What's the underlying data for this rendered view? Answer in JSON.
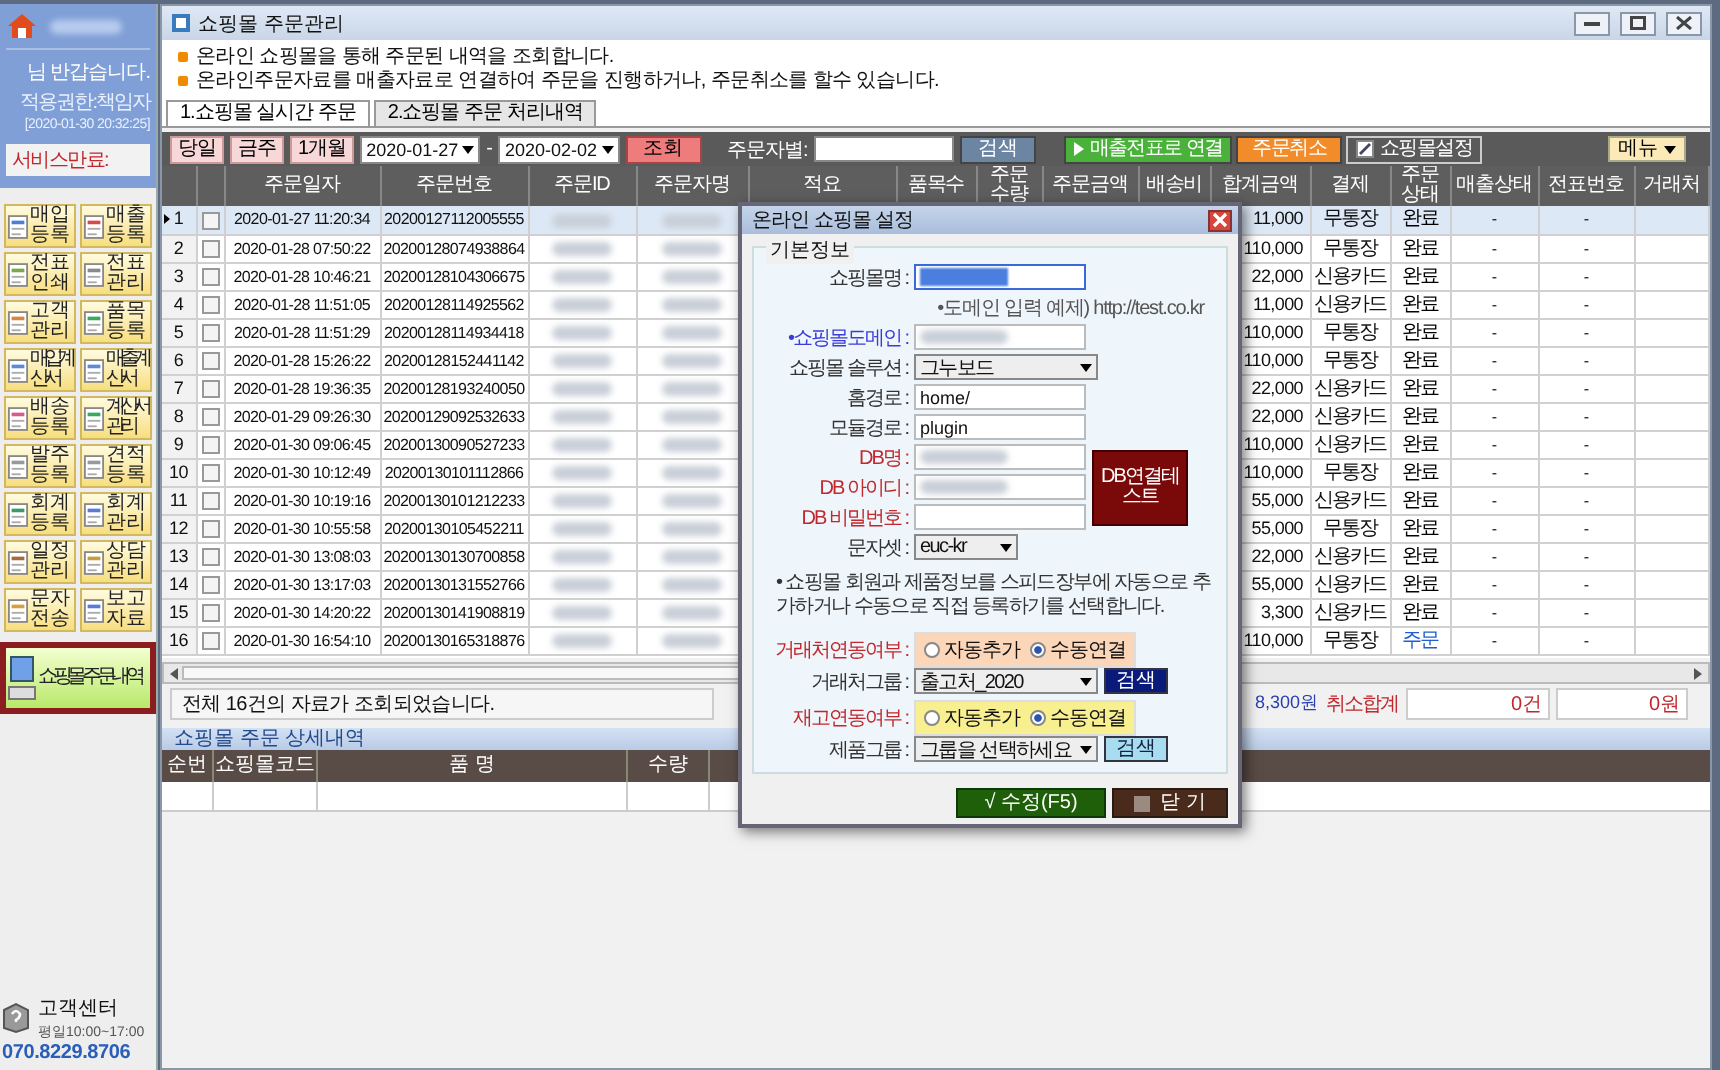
{
  "sidebar": {
    "greeting": "님 반갑습니다.",
    "role": "적용권한:책임자",
    "login_time": "[2020-01-30 20:32:25]",
    "service_label": "서비스만료:",
    "menu": [
      {
        "label": "매입등록"
      },
      {
        "label": "매출등록"
      },
      {
        "label": "전표인쇄"
      },
      {
        "label": "전표관리"
      },
      {
        "label": "고객관리"
      },
      {
        "label": "품목등록"
      },
      {
        "label": "매입계산서"
      },
      {
        "label": "매출계산서"
      },
      {
        "label": "배송등록"
      },
      {
        "label": "계산서관리"
      },
      {
        "label": "발주등록"
      },
      {
        "label": "견적등록"
      },
      {
        "label": "회계등록"
      },
      {
        "label": "회계관리"
      },
      {
        "label": "일정관리"
      },
      {
        "label": "상담관리"
      },
      {
        "label": "문자전송"
      },
      {
        "label": "보고자료"
      }
    ],
    "featured": {
      "label": "쇼핑몰 주문내역",
      "selected": true
    },
    "support": {
      "title": "고객센터",
      "hours": "평일10:00~17:00",
      "phone": "070.8229.8706"
    }
  },
  "window": {
    "title": "쇼핑몰 주문관리"
  },
  "notices": [
    "온라인 쇼핑몰을 통해 주문된 내역을 조회합니다.",
    "온라인주문자료를 매출자료로 연결하여 주문을 진행하거나, 주문취소를 할수 있습니다."
  ],
  "tabs": [
    {
      "label": "1.쇼핑몰 실시간 주문",
      "selected": true
    },
    {
      "label": "2.쇼핑몰 주문 처리내역",
      "selected": false
    }
  ],
  "toolbar": {
    "quick": [
      "당일",
      "금주",
      "1개월"
    ],
    "date_from": "2020-01-27",
    "separator": "-",
    "date_to": "2020-02-02",
    "search_button": "조회",
    "orderer_label": "주문자별:",
    "find_button": "검색",
    "actions": [
      {
        "label": "매출전표로 연결",
        "kind": "link"
      },
      {
        "label": "주문취소",
        "kind": "cancel"
      },
      {
        "label": "쇼핑몰설정",
        "kind": "settings"
      }
    ],
    "menu_button": "메뉴"
  },
  "table": {
    "columns": [
      "주문일자",
      "주문번호",
      "주문ID",
      "주문자명",
      "적요",
      "품목수",
      "주문수량",
      "주문금액",
      "배송비",
      "합계금액",
      "결제",
      "주문상태",
      "매출상태",
      "전표번호",
      "거래처"
    ],
    "rows": [
      {
        "number": "1",
        "selected": true,
        "checked": false,
        "date": "2020-01-27 11:20:34",
        "order_no": "20200127112005555",
        "total": "11,000",
        "payment": "무통장",
        "status": {
          "text": "완료",
          "color": "#000000"
        },
        "sales_status": "-",
        "slip_no": "-"
      },
      {
        "number": "2",
        "selected": false,
        "checked": false,
        "date": "2020-01-28 07:50:22",
        "order_no": "20200128074938864",
        "total": "110,000",
        "payment": "무통장",
        "status": {
          "text": "완료",
          "color": "#000000"
        },
        "sales_status": "-",
        "slip_no": "-"
      },
      {
        "number": "3",
        "selected": false,
        "checked": false,
        "date": "2020-01-28 10:46:21",
        "order_no": "20200128104306675",
        "total": "22,000",
        "payment": "신용카드",
        "status": {
          "text": "완료",
          "color": "#000000"
        },
        "sales_status": "-",
        "slip_no": "-"
      },
      {
        "number": "4",
        "selected": false,
        "checked": false,
        "date": "2020-01-28 11:51:05",
        "order_no": "20200128114925562",
        "total": "11,000",
        "payment": "신용카드",
        "status": {
          "text": "완료",
          "color": "#000000"
        },
        "sales_status": "-",
        "slip_no": "-"
      },
      {
        "number": "5",
        "selected": false,
        "checked": false,
        "date": "2020-01-28 11:51:29",
        "order_no": "20200128114934418",
        "total": "110,000",
        "payment": "무통장",
        "status": {
          "text": "완료",
          "color": "#000000"
        },
        "sales_status": "-",
        "slip_no": "-"
      },
      {
        "number": "6",
        "selected": false,
        "checked": false,
        "date": "2020-01-28 15:26:22",
        "order_no": "20200128152441142",
        "total": "110,000",
        "payment": "무통장",
        "status": {
          "text": "완료",
          "color": "#000000"
        },
        "sales_status": "-",
        "slip_no": "-"
      },
      {
        "number": "7",
        "selected": false,
        "checked": false,
        "date": "2020-01-28 19:36:35",
        "order_no": "20200128193240050",
        "total": "22,000",
        "payment": "신용카드",
        "status": {
          "text": "완료",
          "color": "#000000"
        },
        "sales_status": "-",
        "slip_no": "-"
      },
      {
        "number": "8",
        "selected": false,
        "checked": false,
        "date": "2020-01-29 09:26:30",
        "order_no": "20200129092532633",
        "total": "22,000",
        "payment": "신용카드",
        "status": {
          "text": "완료",
          "color": "#000000"
        },
        "sales_status": "-",
        "slip_no": "-"
      },
      {
        "number": "9",
        "selected": false,
        "checked": false,
        "date": "2020-01-30 09:06:45",
        "order_no": "20200130090527233",
        "total": "110,000",
        "payment": "신용카드",
        "status": {
          "text": "완료",
          "color": "#000000"
        },
        "sales_status": "-",
        "slip_no": "-"
      },
      {
        "number": "10",
        "selected": false,
        "checked": false,
        "date": "2020-01-30 10:12:49",
        "order_no": "20200130101112866",
        "total": "110,000",
        "payment": "무통장",
        "status": {
          "text": "완료",
          "color": "#000000"
        },
        "sales_status": "-",
        "slip_no": "-"
      },
      {
        "number": "11",
        "selected": false,
        "checked": false,
        "date": "2020-01-30 10:19:16",
        "order_no": "20200130101212233",
        "total": "55,000",
        "payment": "신용카드",
        "status": {
          "text": "완료",
          "color": "#000000"
        },
        "sales_status": "-",
        "slip_no": "-"
      },
      {
        "number": "12",
        "selected": false,
        "checked": false,
        "date": "2020-01-30 10:55:58",
        "order_no": "20200130105452211",
        "total": "55,000",
        "payment": "무통장",
        "status": {
          "text": "완료",
          "color": "#000000"
        },
        "sales_status": "-",
        "slip_no": "-"
      },
      {
        "number": "13",
        "selected": false,
        "checked": false,
        "date": "2020-01-30 13:08:03",
        "order_no": "20200130130700858",
        "total": "22,000",
        "payment": "신용카드",
        "status": {
          "text": "완료",
          "color": "#000000"
        },
        "sales_status": "-",
        "slip_no": "-"
      },
      {
        "number": "14",
        "selected": false,
        "checked": false,
        "date": "2020-01-30 13:17:03",
        "order_no": "20200130131552766",
        "total": "55,000",
        "payment": "신용카드",
        "status": {
          "text": "완료",
          "color": "#000000"
        },
        "sales_status": "-",
        "slip_no": "-"
      },
      {
        "number": "15",
        "selected": false,
        "checked": false,
        "date": "2020-01-30 14:20:22",
        "order_no": "20200130141908819",
        "total": "3,300",
        "payment": "신용카드",
        "status": {
          "text": "완료",
          "color": "#000000"
        },
        "sales_status": "-",
        "slip_no": "-"
      },
      {
        "number": "16",
        "selected": false,
        "checked": false,
        "date": "2020-01-30 16:54:10",
        "order_no": "20200130165318876",
        "total": "110,000",
        "payment": "무통장",
        "status": {
          "text": "주문",
          "color": "#1f5fd0"
        },
        "sales_status": "-",
        "slip_no": "-"
      }
    ]
  },
  "status_bar": {
    "message": "전체 16건의 자료가 조회되었습니다.",
    "total_amount": "8,300원",
    "cancel_label": "취소합계",
    "cancel_count": "0건",
    "cancel_amount": "0원"
  },
  "detail_panel": {
    "title": "쇼핑몰 주문 상세내역",
    "columns": [
      "순번",
      "쇼핑몰코드",
      "품 명",
      "수량"
    ]
  },
  "dialog": {
    "title": "온라인 쇼핑몰 설정",
    "group": "기본정보",
    "fields": [
      {
        "kind": "input",
        "label": {
          "text": "쇼핑몰명 :",
          "color": "#333333"
        },
        "selected": true
      },
      {
        "kind": "hint",
        "text": "•도메인 입력 예제) http://test.co.kr"
      },
      {
        "kind": "input",
        "label": {
          "text": "•쇼핑몰도메인 :",
          "color": "#3b3bd8"
        },
        "selected": false
      },
      {
        "kind": "select",
        "label": {
          "text": "쇼핑몰 솔루션 :",
          "color": "#333333"
        },
        "value": "그누보드"
      },
      {
        "kind": "input",
        "label": {
          "text": "홈경로 :",
          "color": "#333333"
        },
        "value": "home/"
      },
      {
        "kind": "input",
        "label": {
          "text": "모듈경로 :",
          "color": "#333333"
        },
        "value": "plugin"
      }
    ],
    "db_fields": [
      {
        "label": {
          "text": "DB명 :",
          "color": "#c0282d"
        },
        "blurred": true
      },
      {
        "label": {
          "text": "DB 아이디 :",
          "color": "#c0282d"
        },
        "blurred": true
      },
      {
        "label": {
          "text": "DB 비밀번호 :",
          "color": "#c0282d"
        },
        "blurred": false
      }
    ],
    "db_test_button": "DB연결테스트",
    "charset": {
      "label": "문자셋 :",
      "value": "euc-kr"
    },
    "note": "• 쇼핑몰 회원과 제품정보를 스피드장부에 자동으로 추가하거나 수동으로 직접 등록하기를 선택합니다.",
    "links": [
      {
        "label": {
          "text": "거래처연동여부 :",
          "color": "#c0282d"
        },
        "choices": {
          "color": "#fcd6b8",
          "options": [
            {
              "label": "자동추가",
              "selected": false
            },
            {
              "label": "수동연결",
              "selected": true
            }
          ]
        },
        "group_label": "거래처그룹 :",
        "group_value": "출고처_2020",
        "search": {
          "label": "검색",
          "color": "#0a1a7a"
        }
      },
      {
        "label": {
          "text": "재고연동여부 :",
          "color": "#c0282d"
        },
        "choices": {
          "color": "#f8ef90",
          "options": [
            {
              "label": "자동추가",
              "selected": false
            },
            {
              "label": "수동연결",
              "selected": true
            }
          ]
        },
        "group_label": "제품그룹 :",
        "group_value": "그룹을 선택하세요",
        "search": {
          "label": "검색",
          "color": "#a8dcef"
        }
      }
    ],
    "save_button": "√ 수정(F5)",
    "close_button": "닫 기"
  }
}
